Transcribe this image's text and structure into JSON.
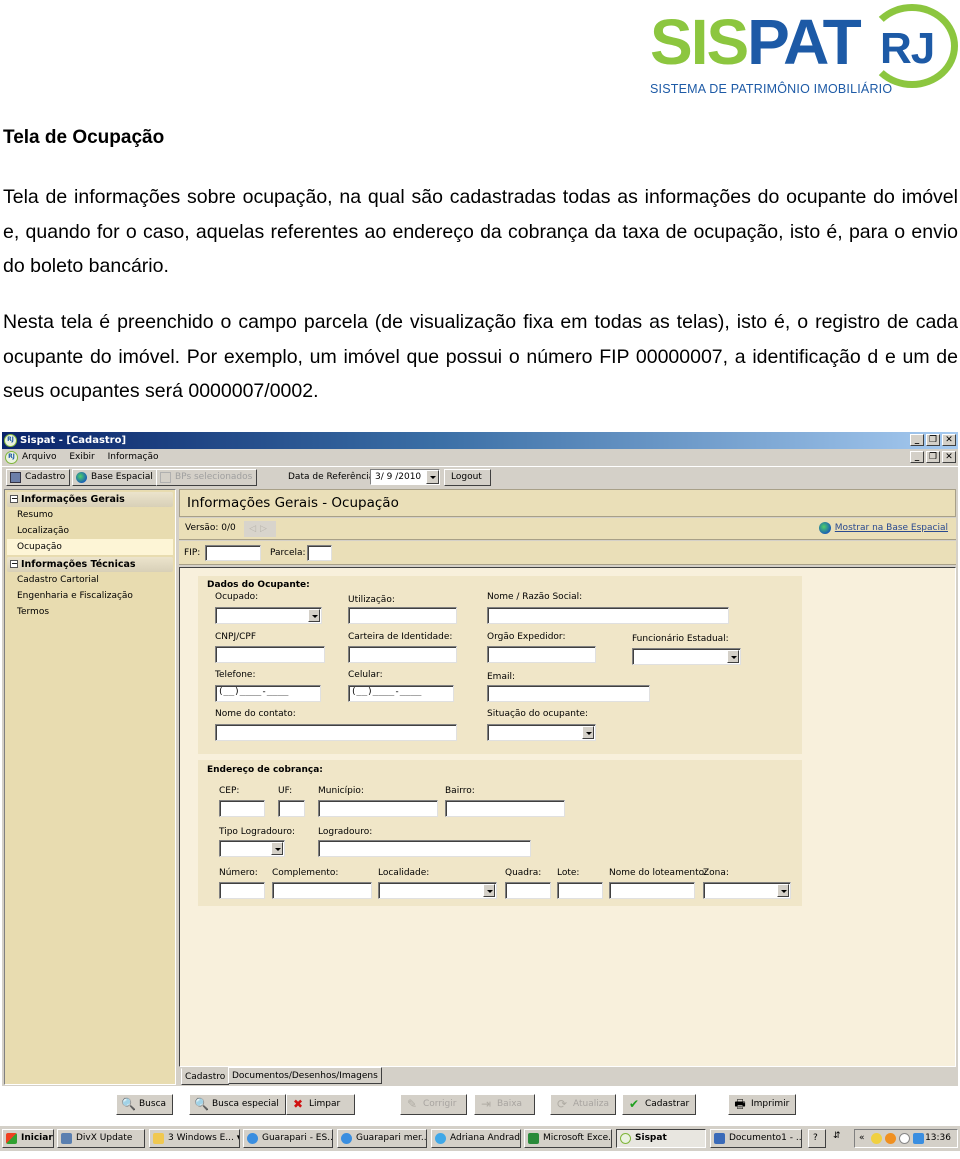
{
  "logo": {
    "sis": "SIS",
    "pat": "PAT",
    "rj": "RJ",
    "tagline": "SISTEMA DE PATRIMÔNIO IMOBILIÁRIO",
    "colors": {
      "green": "#8cc63f",
      "blue": "#1d5aa6"
    }
  },
  "document": {
    "title": "Tela de Ocupação",
    "paragraphs": [
      "Tela de informações sobre ocupação, na qual são cadastradas todas as informações do ocupante do imóvel e, quando for o caso, aquelas referentes ao endereço da cobrança da taxa de ocupação, isto é, para o envio do boleto bancário.",
      "Nesta tela é preenchido o campo parcela (de visualização fixa em todas as telas), isto é, o registro de cada ocupante do imóvel. Por exemplo, um imóvel que possui o número FIP 00000007, a identificação d e um de seus ocupantes será 0000007/0002."
    ]
  },
  "window": {
    "title": "Sispat - [Cadastro]",
    "app_icon": "RJ",
    "controls": {
      "minimize": "_",
      "restore": "❐",
      "close": "✕"
    },
    "menu": [
      "Arquivo",
      "Exibir",
      "Informação"
    ],
    "toolbar": {
      "cadastro": "Cadastro",
      "base_espacial": "Base Espacial",
      "bps_selecionados": "BPs selecionados",
      "data_ref_label": "Data de Referência:",
      "data_ref_value": "3/ 9 /2010",
      "logout": "Logout"
    },
    "sidebar": {
      "groups": [
        {
          "label": "Informações Gerais",
          "toggle": "−",
          "items": [
            "Resumo",
            "Localização",
            "Ocupação"
          ]
        },
        {
          "label": "Informações Técnicas",
          "toggle": "−",
          "items": [
            "Cadastro Cartorial",
            "Engenharia e Fiscalização",
            "Termos"
          ]
        }
      ],
      "active_item": "Ocupação"
    },
    "panel": {
      "heading": "Informações Gerais - Ocupação",
      "version_label": "Versão: 0/0",
      "nav_prev": "◁",
      "nav_next": "▷",
      "show_base_link": "Mostrar na Base Espacial",
      "fip_label": "FIP:",
      "fip_value": "",
      "parcela_label": "Parcela:",
      "parcela_value": ""
    },
    "dados_ocupante": {
      "title": "Dados do Ocupante:",
      "ocupado": "Ocupado:",
      "utilizacao": "Utilização:",
      "nome_razao": "Nome / Razão Social:",
      "cnpj_cpf": "CNPJ/CPF",
      "carteira": "Carteira de Identidade:",
      "orgao": "Orgão Expedidor:",
      "funcionario": "Funcionário Estadual:",
      "telefone": "Telefone:",
      "telefone_mask": "(__)____-____",
      "celular": "Celular:",
      "celular_mask": "(__)____-____",
      "email": "Email:",
      "nome_contato": "Nome do contato:",
      "situacao": "Situação do ocupante:"
    },
    "endereco_cobranca": {
      "title": "Endereço de cobrança:",
      "cep": "CEP:",
      "uf": "UF:",
      "municipio": "Município:",
      "bairro": "Bairro:",
      "tipo_logradouro": "Tipo Logradouro:",
      "logradouro": "Logradouro:",
      "numero": "Número:",
      "complemento": "Complemento:",
      "localidade": "Localidade:",
      "quadra": "Quadra:",
      "lote": "Lote:",
      "nome_loteamento": "Nome do loteamento:",
      "zona": "Zona:"
    },
    "tabs": [
      "Cadastro",
      "Documentos/Desenhos/Imagens"
    ],
    "active_tab": "Cadastro",
    "actions": {
      "busca": "Busca",
      "busca_especial": "Busca especial",
      "limpar": "Limpar",
      "corrigir": "Corrigir",
      "baixa": "Baixa",
      "atualiza": "Atualiza",
      "cadastrar": "Cadastrar",
      "imprimir": "Imprimir"
    }
  },
  "taskbar": {
    "start": "Iniciar",
    "tasks": [
      "DivX Update",
      "3 Windows E... ▾",
      "Guarapari - ES...",
      "Guarapari mer...",
      "Adriana Andrade",
      "Microsoft Exce...",
      "Sispat",
      "Documento1 - ..."
    ],
    "active_task": "Sispat",
    "help": "?",
    "tray_chevron": "«",
    "clock": "13:36"
  }
}
